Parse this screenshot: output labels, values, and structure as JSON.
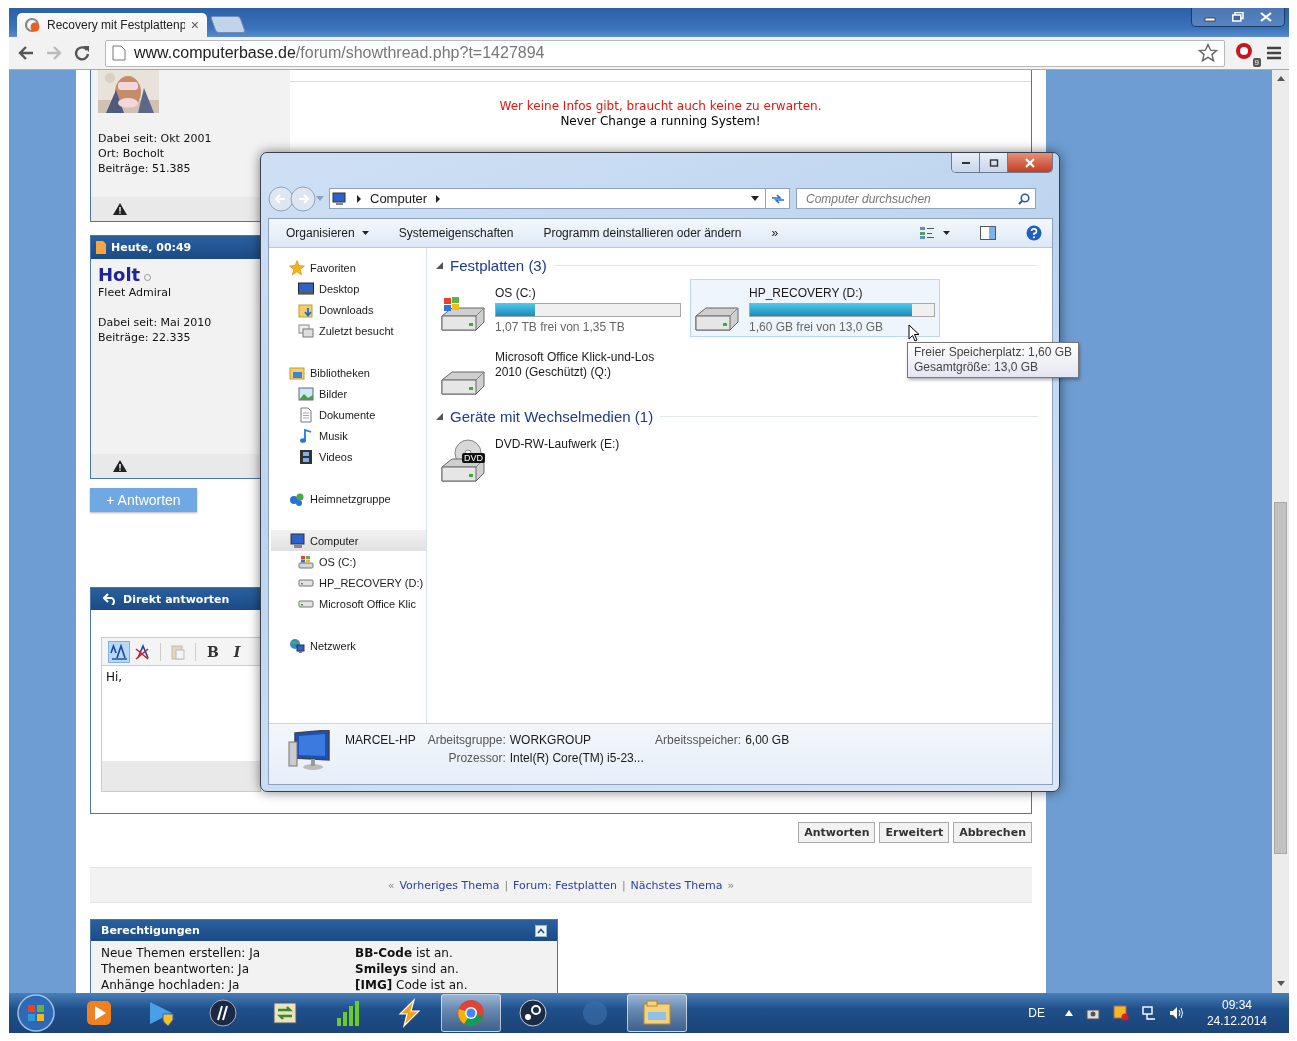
{
  "browser": {
    "tabs": [
      {
        "title": "Recovery mit Festplattenp",
        "selected": true,
        "close": "×"
      }
    ],
    "address": {
      "host": "www.computerbase.de",
      "path": "/forum/showthread.php?t=1427894"
    },
    "extension_badge": "9"
  },
  "forum": {
    "post_top": {
      "member_info": [
        "Dabei seit: Okt 2001",
        "Ort: Bocholt",
        "Beiträge: 51.385"
      ],
      "signature": [
        {
          "text": "Wer keine Infos gibt, braucht auch keine zu erwarten.",
          "color": "#e8140e"
        },
        {
          "text": "Never Change a running System!",
          "color": "#000000"
        }
      ]
    },
    "post": {
      "time": "Heute, 00:49",
      "author": "Holt",
      "online": false,
      "rank": "Fleet Admiral",
      "member_info": [
        "Dabei seit: Mai 2010",
        "Beiträge: 22.335"
      ]
    },
    "reply_button": "+ Antworten",
    "quick_reply": {
      "title": "Direkt antworten",
      "text": "Hi,",
      "tools": [
        {
          "kind": "switch-mode",
          "active": true
        },
        {
          "kind": "remove-format",
          "active": false
        },
        {
          "kind": "paste",
          "active": false
        },
        {
          "kind": "bold",
          "text": "B",
          "active": false
        },
        {
          "kind": "italic",
          "text": "I",
          "active": false
        }
      ]
    },
    "form_buttons": [
      "Antworten",
      "Erweitert",
      "Abbrechen"
    ],
    "thread_nav": [
      {
        "kind": "glyph",
        "text": "«"
      },
      {
        "kind": "link",
        "text": "Vorheriges Thema"
      },
      {
        "kind": "sep",
        "text": "|"
      },
      {
        "kind": "link",
        "text": "Forum: Festplatten"
      },
      {
        "kind": "sep",
        "text": "|"
      },
      {
        "kind": "link",
        "text": "Nächstes Thema"
      },
      {
        "kind": "glyph",
        "text": "»"
      }
    ],
    "permissions": {
      "title": "Berechtigungen",
      "rows": [
        {
          "left": "Neue Themen erstellen: Ja",
          "right": "**BB-Code** ist an."
        },
        {
          "left": "Themen beantworten: Ja",
          "right": "**Smileys** sind an."
        },
        {
          "left": "Anhänge hochladen: Ja",
          "right": "**[IMG]** Code ist an."
        }
      ]
    }
  },
  "explorer": {
    "breadcrumb": [
      "Computer"
    ],
    "search": {
      "placeholder": "Computer durchsuchen"
    },
    "toolbar": [
      {
        "label": "Organisieren",
        "menu": true
      },
      {
        "label": "Systemeigenschaften",
        "menu": false
      },
      {
        "label": "Programm deinstallieren oder ändern",
        "menu": false
      }
    ],
    "toolbar_more": "»",
    "nav": [
      {
        "kind": "favorites",
        "label": "Favoriten",
        "selected": false,
        "children": [
          {
            "kind": "desktop",
            "label": "Desktop",
            "selected": false
          },
          {
            "kind": "downloads",
            "label": "Downloads",
            "selected": false
          },
          {
            "kind": "recent",
            "label": "Zuletzt besucht",
            "selected": false
          }
        ]
      },
      {
        "kind": "libraries",
        "label": "Bibliotheken",
        "selected": false,
        "children": [
          {
            "kind": "pictures",
            "label": "Bilder",
            "selected": false
          },
          {
            "kind": "documents",
            "label": "Dokumente",
            "selected": false
          },
          {
            "kind": "music",
            "label": "Musik",
            "selected": false
          },
          {
            "kind": "videos",
            "label": "Videos",
            "selected": false
          }
        ]
      },
      {
        "kind": "homegroup",
        "label": "Heimnetzgruppe",
        "selected": false
      },
      {
        "kind": "computer",
        "label": "Computer",
        "selected": true,
        "children": [
          {
            "kind": "os-drive",
            "label": "OS (C:)",
            "selected": false
          },
          {
            "kind": "drive",
            "label": "HP_RECOVERY (D:)",
            "selected": false
          },
          {
            "kind": "drive",
            "label": "Microsoft Office Klic",
            "selected": false
          }
        ]
      },
      {
        "kind": "network",
        "label": "Netzwerk",
        "selected": false
      }
    ],
    "sections": [
      {
        "title": "Festplatten (3)",
        "expanded": true,
        "items": [
          {
            "kind": "os-drive",
            "name": "OS (C:)",
            "level": 0.21,
            "free": "1,07 TB frei von 1,35 TB",
            "hovered": false
          },
          {
            "kind": "drive",
            "name": "HP_RECOVERY (D:)",
            "level": 0.88,
            "free": "1,60 GB frei von 13,0 GB",
            "hovered": true
          },
          {
            "kind": "drive",
            "name": "Microsoft Office Klick-und-Los 2010 (Geschützt) (Q:)",
            "hovered": false
          }
        ]
      },
      {
        "title": "Geräte mit Wechselmedien (1)",
        "expanded": true,
        "items": [
          {
            "kind": "dvd",
            "name": "DVD-RW-Laufwerk (E:)",
            "badge": "DVD",
            "hovered": false
          }
        ]
      }
    ],
    "tooltip": [
      "Freier Speicherplatz: 1,60 GB",
      "Gesamtgröße: 13,0 GB"
    ],
    "details": {
      "name": "MARCEL-HP",
      "fields": [
        {
          "label": "Arbeitsgruppe:",
          "value": "WORKGROUP"
        },
        {
          "label": "Arbeitsspeicher:",
          "value": "6,00 GB"
        },
        {
          "label": "Prozessor:",
          "value": "Intel(R) Core(TM) i5-23..."
        }
      ]
    }
  },
  "taskbar": {
    "apps": [
      {
        "kind": "media",
        "running": false
      },
      {
        "kind": "arrow-shield",
        "running": false
      },
      {
        "kind": "hp",
        "running": false
      },
      {
        "kind": "sync",
        "running": false
      },
      {
        "kind": "signal",
        "running": false
      },
      {
        "kind": "bolt",
        "running": false
      },
      {
        "kind": "chrome",
        "running": true
      },
      {
        "kind": "steam",
        "running": false
      },
      {
        "kind": "faded",
        "running": false
      },
      {
        "kind": "folder",
        "running": true
      }
    ],
    "language": "DE",
    "time": "09:34",
    "date": "24.12.2014"
  }
}
